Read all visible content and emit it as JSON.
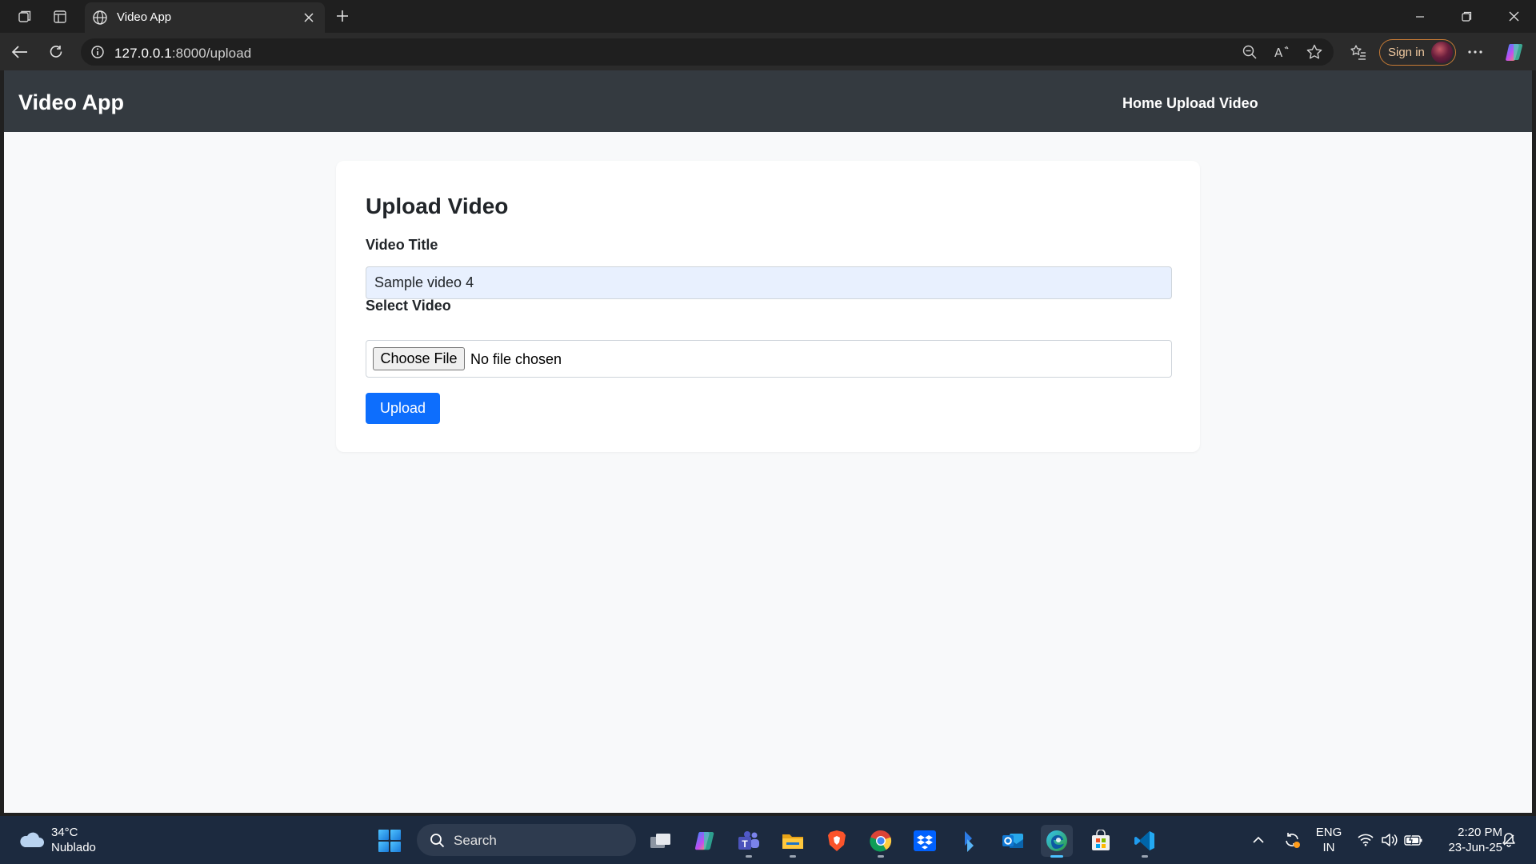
{
  "browser": {
    "tab_title": "Video App",
    "url_host": "127.0.0.1",
    "url_path": ":8000/upload",
    "signin_label": "Sign in"
  },
  "navbar": {
    "brand": "Video App",
    "links": [
      "Home",
      "Upload Video"
    ]
  },
  "upload_form": {
    "heading": "Upload Video",
    "title_label": "Video Title",
    "title_value": "Sample video 4",
    "file_label": "Select Video",
    "choose_button": "Choose File",
    "file_status": "No file chosen",
    "submit_label": "Upload"
  },
  "taskbar": {
    "weather_temp": "34°C",
    "weather_desc": "Nublado",
    "search_label": "Search",
    "lang_line1": "ENG",
    "lang_line2": "IN",
    "time": "2:20 PM",
    "date": "23-Jun-25",
    "apps": [
      "task-view",
      "copilot",
      "teams",
      "file-explorer",
      "brave",
      "chrome",
      "dropbox",
      "power-automate",
      "outlook",
      "edge",
      "microsoft-store",
      "vscode"
    ]
  },
  "colors": {
    "navbar_bg": "#343a40",
    "page_bg": "#f8f9fa",
    "primary_button": "#0d6efd",
    "autofill_input_bg": "#e8f0fe",
    "taskbar_bg": "#1c2a3f"
  }
}
